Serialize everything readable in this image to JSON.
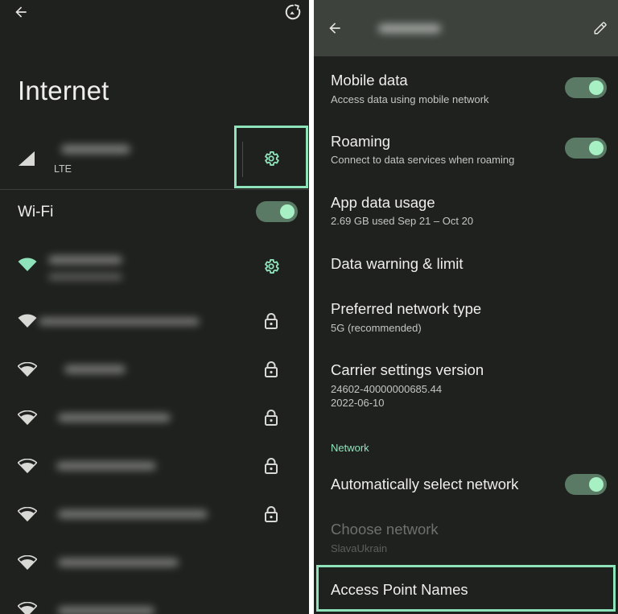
{
  "left": {
    "title": "Internet",
    "mobile_network": {
      "type_label": "LTE"
    },
    "wifi": {
      "label": "Wi-Fi",
      "enabled": true,
      "networks": [
        {
          "icon": "wifi-full-icon",
          "trailing": "gear-icon",
          "connected": true
        },
        {
          "icon": "wifi-full-icon",
          "trailing": "lock-icon",
          "connected": false
        },
        {
          "icon": "wifi-strong-icon",
          "trailing": "lock-icon",
          "connected": false
        },
        {
          "icon": "wifi-strong-icon",
          "trailing": "lock-icon",
          "connected": false
        },
        {
          "icon": "wifi-strong-icon",
          "trailing": "lock-icon",
          "connected": false
        },
        {
          "icon": "wifi-strong-icon",
          "trailing": "lock-icon",
          "connected": false
        },
        {
          "icon": "wifi-strong-icon",
          "trailing": "none",
          "connected": false
        },
        {
          "icon": "wifi-strong-icon",
          "trailing": "none",
          "connected": false
        }
      ]
    }
  },
  "right": {
    "items": [
      {
        "title": "Mobile data",
        "subtitle": "Access data using mobile network",
        "toggle": true
      },
      {
        "title": "Roaming",
        "subtitle": "Connect to data services when roaming",
        "toggle": true
      },
      {
        "title": "App data usage",
        "subtitle": "2.69 GB used Sep 21 – Oct 20"
      },
      {
        "title": "Data warning & limit"
      },
      {
        "title": "Preferred network type",
        "subtitle": "5G (recommended)"
      },
      {
        "title": "Carrier settings version",
        "subtitle": "24602-40000000685.44",
        "subtitle2": "2022-06-10"
      }
    ],
    "network_section": {
      "header": "Network",
      "auto_select": {
        "title": "Automatically select network",
        "toggle": true
      },
      "choose_network": {
        "title": "Choose network",
        "subtitle": "SlavaUkrain",
        "disabled": true
      },
      "apn": {
        "title": "Access Point Names"
      }
    }
  },
  "colors": {
    "background": "#1f211f",
    "topbar": "#3d423d",
    "accent": "#8fe3ba",
    "toggle_track": "#5b7a66",
    "toggle_knob": "#a7f0c4"
  }
}
